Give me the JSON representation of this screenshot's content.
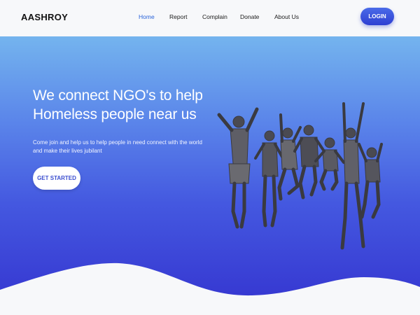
{
  "navbar": {
    "brand": "AASHROY",
    "links": [
      {
        "label": "Home",
        "active": true
      },
      {
        "label": "Report",
        "active": false
      },
      {
        "label": "Complain",
        "active": false
      },
      {
        "label": "Donate",
        "active": false
      },
      {
        "label": "About Us",
        "active": false
      }
    ],
    "login_label": "LOGIN"
  },
  "hero": {
    "headline_line1": "We connect NGO's to help",
    "headline_line2": "Homeless people near us",
    "subtext": "Come join and help us to help people in need connect with the world and make their lives jubilant",
    "cta_label": "GET STARTED",
    "image": "group-of-children-jumping-photo"
  },
  "colors": {
    "accent": "#2a63d9",
    "hero_gradient_top": "#74b4ee",
    "hero_gradient_bottom": "#3433cf",
    "button_text": "#3c4fd0"
  }
}
